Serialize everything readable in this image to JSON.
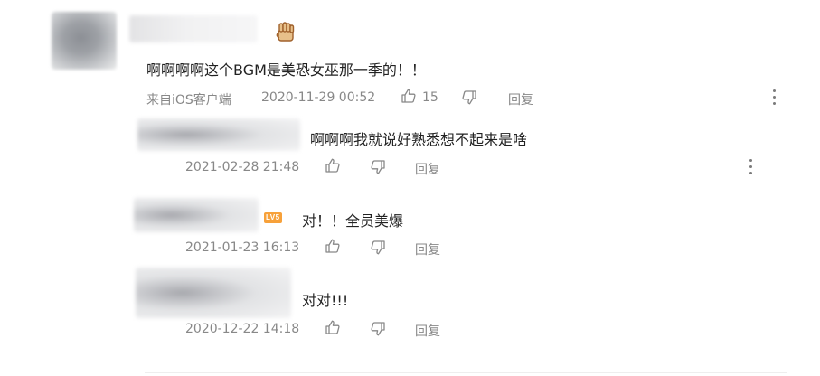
{
  "main_comment": {
    "text": "啊啊啊啊这个BGM是美恐女巫那一季的！！",
    "source": "来自iOS客户端",
    "timestamp": "2020-11-29 00:52",
    "like_count": "15",
    "reply_label": "回复",
    "badge_icon": "fist-icon"
  },
  "replies": [
    {
      "text": "啊啊啊我就说好熟悉想不起来是啥",
      "timestamp": "2021-02-28 21:48",
      "reply_label": "回复"
    },
    {
      "badge": "LV5",
      "text": "对！！全员美爆",
      "timestamp": "2021-01-23 16:13",
      "reply_label": "回复"
    },
    {
      "text": "对对!!!",
      "timestamp": "2020-12-22 14:18",
      "reply_label": "回复"
    }
  ],
  "colors": {
    "text": "#222222",
    "meta": "#888888",
    "badge_bg": "#f7a13a",
    "fist_fill": "#e7c08a",
    "fist_stroke": "#a0612c"
  }
}
